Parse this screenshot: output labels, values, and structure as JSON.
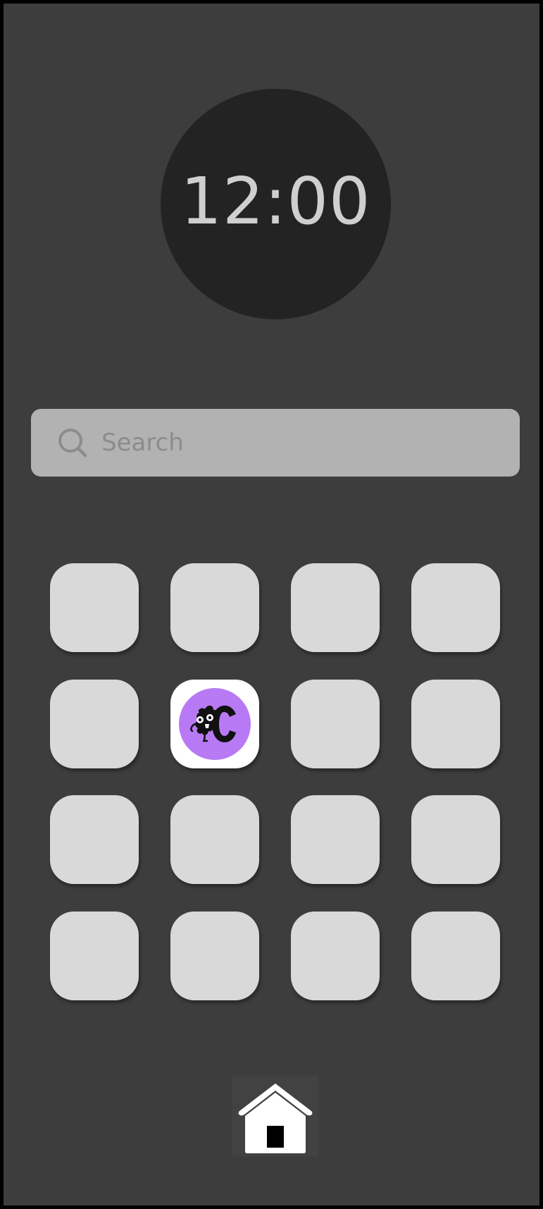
{
  "clock": {
    "time": "12:00"
  },
  "search": {
    "placeholder": "Search",
    "icon": "search-icon"
  },
  "app_grid": {
    "rows": 4,
    "columns": 4,
    "tiles": [
      {
        "icon": null
      },
      {
        "icon": null
      },
      {
        "icon": null
      },
      {
        "icon": null
      },
      {
        "icon": null
      },
      {
        "icon": "purple-c-monster-app-icon"
      },
      {
        "icon": null
      },
      {
        "icon": null
      },
      {
        "icon": null
      },
      {
        "icon": null
      },
      {
        "icon": null
      },
      {
        "icon": null
      },
      {
        "icon": null
      },
      {
        "icon": null
      },
      {
        "icon": null
      },
      {
        "icon": null
      }
    ]
  },
  "home": {
    "icon": "home-icon"
  },
  "colors": {
    "background": "#3d3d3d",
    "clock_face": "#232323",
    "clock_text": "#cfcfcf",
    "search_bar": "#b2b2b2",
    "tile": "#d9d9d9",
    "app_icon_purple": "#b87af4"
  }
}
